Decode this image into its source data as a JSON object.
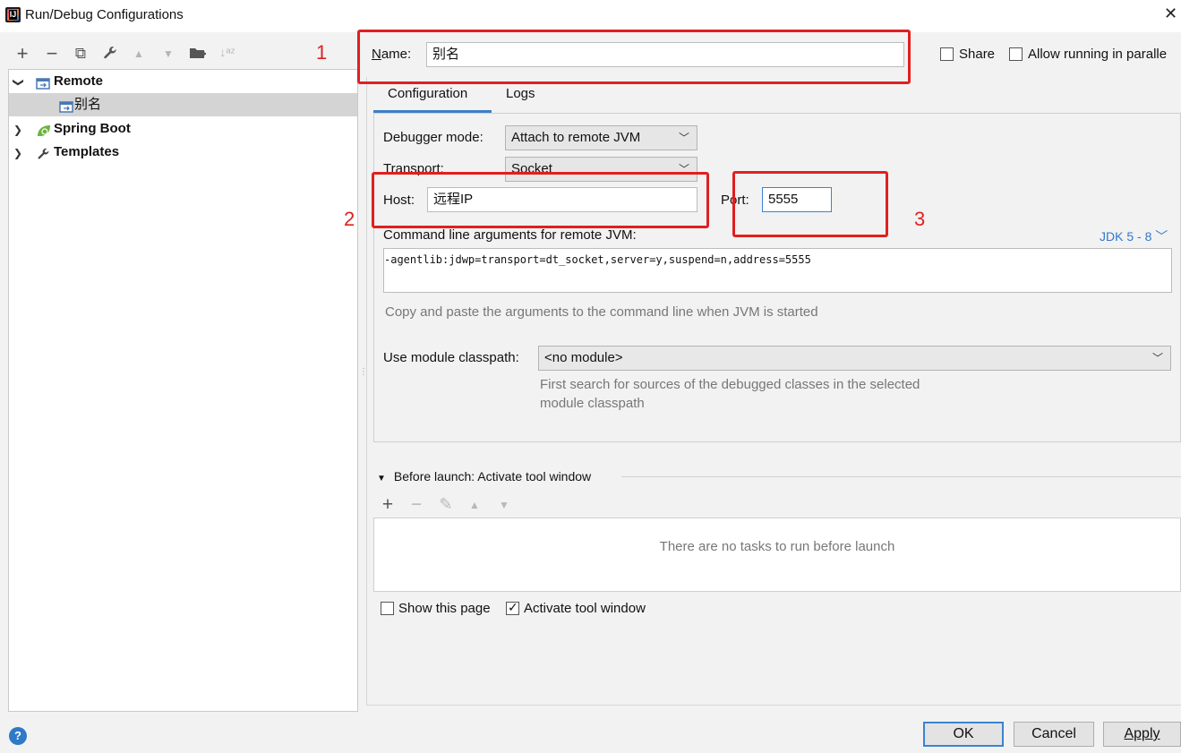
{
  "window": {
    "title": "Run/Debug Configurations",
    "close_glyph": "✕"
  },
  "toolbar": {
    "icons": [
      "add-icon",
      "remove-icon",
      "copy-icon",
      "wrench-icon",
      "move-up-icon",
      "move-down-icon",
      "new-folder-icon",
      "sort-icon"
    ],
    "glyphs": {
      "add": "+",
      "remove": "−",
      "copy": "⧉",
      "wrench": "🔧",
      "up": "▲",
      "down": "▼",
      "folder": "▆",
      "sort": "↓ᵃᶻ"
    }
  },
  "tree": {
    "items": [
      {
        "label": "Remote",
        "expanded": true
      },
      {
        "label": "别名",
        "selected": true
      },
      {
        "label": "Spring Boot",
        "expanded": false
      },
      {
        "label": "Templates",
        "expanded": false
      }
    ],
    "arrow_down": "❯",
    "arrow_right": "❯"
  },
  "name_row": {
    "label_underline_char": "N",
    "label_rest": "ame:",
    "value": "别名",
    "share_label": "Share",
    "allow_parallel_label": "Allow running in paralle"
  },
  "tabs": [
    {
      "label": "Configuration",
      "active": true
    },
    {
      "label": "Logs",
      "active": false
    }
  ],
  "config": {
    "debugger_mode_label": "Debugger mode:",
    "debugger_mode_value": "Attach to remote JVM",
    "transport_label": "Transport:",
    "transport_value": "Socket",
    "host_label": "Host:",
    "host_value": "远程IP",
    "port_label": "Port:",
    "port_value": "5555",
    "cmd_label": "Command line arguments for remote JVM:",
    "jdk_link": "JDK 5 - 8",
    "cmd_value": "-agentlib:jdwp=transport=dt_socket,server=y,suspend=n,address=5555",
    "cmd_hint": "Copy and paste the arguments to the command line when JVM is started",
    "module_label": "Use module classpath:",
    "module_value": "<no module>",
    "module_hint_line1": "First search for sources of the debugged classes in the selected",
    "module_hint_line2": "module classpath"
  },
  "annotations": {
    "n1": "1",
    "n2": "2",
    "n3": "3"
  },
  "before_launch": {
    "header": "Before launch: Activate tool window",
    "glyphs": {
      "add": "+",
      "remove": "−",
      "edit": "✎",
      "up": "▲",
      "down": "▼"
    },
    "empty_text": "There are no tasks to run before launch",
    "show_page_label": "Show this page",
    "show_page_checked": false,
    "activate_label": "Activate tool window",
    "activate_checked": true
  },
  "buttons": {
    "ok": "OK",
    "cancel": "Cancel",
    "apply": "Apply",
    "help": "?"
  },
  "colors": {
    "accent": "#2f79c9",
    "annotation_red": "#e02020",
    "selection": "#d4d4d4"
  }
}
